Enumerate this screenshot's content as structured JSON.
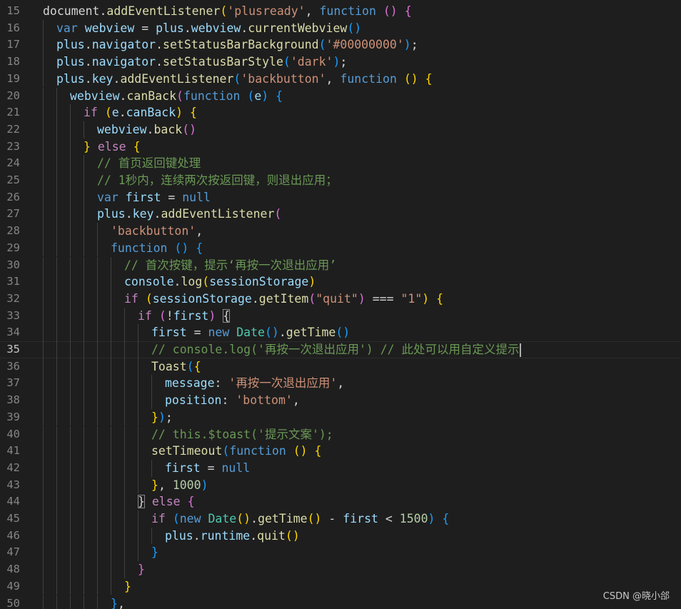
{
  "editor": {
    "current_line": 35,
    "colors": {
      "background": "#1e1e1e",
      "line_number": "#858585",
      "variable": "#9cdcfe",
      "function": "#dcdcaa",
      "keyword": "#569cd6",
      "control": "#c586c0",
      "string": "#ce9178",
      "number": "#b5cea8",
      "comment": "#6a9955",
      "class": "#4ec9b0",
      "bracket_level1": "#ffd700",
      "bracket_level2": "#da70d6",
      "bracket_level3": "#179fff"
    },
    "lines": [
      {
        "num": "15",
        "indent": 0,
        "tokens": [
          [
            "plain",
            "document."
          ],
          [
            "fn",
            "addEventListener"
          ],
          [
            "b1",
            "("
          ],
          [
            "str",
            "'plusready'"
          ],
          [
            "plain",
            ", "
          ],
          [
            "kw",
            "function"
          ],
          [
            "plain",
            " "
          ],
          [
            "b2",
            "()"
          ],
          [
            "plain",
            " "
          ],
          [
            "b2",
            "{"
          ]
        ]
      },
      {
        "num": "16",
        "indent": 1,
        "tokens": [
          [
            "kw",
            "var"
          ],
          [
            "plain",
            " "
          ],
          [
            "var",
            "webview"
          ],
          [
            "plain",
            " = "
          ],
          [
            "var",
            "plus"
          ],
          [
            "plain",
            "."
          ],
          [
            "var",
            "webview"
          ],
          [
            "plain",
            "."
          ],
          [
            "fn",
            "currentWebview"
          ],
          [
            "b3",
            "()"
          ]
        ]
      },
      {
        "num": "17",
        "indent": 1,
        "tokens": [
          [
            "var",
            "plus"
          ],
          [
            "plain",
            "."
          ],
          [
            "var",
            "navigator"
          ],
          [
            "plain",
            "."
          ],
          [
            "fn",
            "setStatusBarBackground"
          ],
          [
            "b3",
            "("
          ],
          [
            "str",
            "'#00000000'"
          ],
          [
            "b3",
            ")"
          ],
          [
            "plain",
            ";"
          ]
        ]
      },
      {
        "num": "18",
        "indent": 1,
        "tokens": [
          [
            "var",
            "plus"
          ],
          [
            "plain",
            "."
          ],
          [
            "var",
            "navigator"
          ],
          [
            "plain",
            "."
          ],
          [
            "fn",
            "setStatusBarStyle"
          ],
          [
            "b3",
            "("
          ],
          [
            "str",
            "'dark'"
          ],
          [
            "b3",
            ")"
          ],
          [
            "plain",
            ";"
          ]
        ]
      },
      {
        "num": "19",
        "indent": 1,
        "tokens": [
          [
            "var",
            "plus"
          ],
          [
            "plain",
            "."
          ],
          [
            "var",
            "key"
          ],
          [
            "plain",
            "."
          ],
          [
            "fn",
            "addEventListener"
          ],
          [
            "b3",
            "("
          ],
          [
            "str",
            "'backbutton'"
          ],
          [
            "plain",
            ", "
          ],
          [
            "kw",
            "function"
          ],
          [
            "plain",
            " "
          ],
          [
            "b1",
            "()"
          ],
          [
            "plain",
            " "
          ],
          [
            "b1",
            "{"
          ]
        ]
      },
      {
        "num": "20",
        "indent": 2,
        "tokens": [
          [
            "var",
            "webview"
          ],
          [
            "plain",
            "."
          ],
          [
            "fn",
            "canBack"
          ],
          [
            "b2",
            "("
          ],
          [
            "kw",
            "function"
          ],
          [
            "plain",
            " "
          ],
          [
            "b3",
            "("
          ],
          [
            "var",
            "e"
          ],
          [
            "b3",
            ")"
          ],
          [
            "plain",
            " "
          ],
          [
            "b3",
            "{"
          ]
        ]
      },
      {
        "num": "21",
        "indent": 3,
        "tokens": [
          [
            "ctrl",
            "if"
          ],
          [
            "plain",
            " "
          ],
          [
            "b1",
            "("
          ],
          [
            "var",
            "e"
          ],
          [
            "plain",
            "."
          ],
          [
            "var",
            "canBack"
          ],
          [
            "b1",
            ")"
          ],
          [
            "plain",
            " "
          ],
          [
            "b1",
            "{"
          ]
        ]
      },
      {
        "num": "22",
        "indent": 4,
        "tokens": [
          [
            "var",
            "webview"
          ],
          [
            "plain",
            "."
          ],
          [
            "fn",
            "back"
          ],
          [
            "b2",
            "()"
          ]
        ]
      },
      {
        "num": "23",
        "indent": 3,
        "tokens": [
          [
            "b1",
            "}"
          ],
          [
            "plain",
            " "
          ],
          [
            "ctrl",
            "else"
          ],
          [
            "plain",
            " "
          ],
          [
            "b1",
            "{"
          ]
        ]
      },
      {
        "num": "24",
        "indent": 4,
        "tokens": [
          [
            "com",
            "// 首页返回键处理"
          ]
        ]
      },
      {
        "num": "25",
        "indent": 4,
        "tokens": [
          [
            "com",
            "// 1秒内，连续两次按返回键，则退出应用；"
          ]
        ]
      },
      {
        "num": "26",
        "indent": 4,
        "tokens": [
          [
            "kw",
            "var"
          ],
          [
            "plain",
            " "
          ],
          [
            "var",
            "first"
          ],
          [
            "plain",
            " = "
          ],
          [
            "kw",
            "null"
          ]
        ]
      },
      {
        "num": "27",
        "indent": 4,
        "tokens": [
          [
            "var",
            "plus"
          ],
          [
            "plain",
            "."
          ],
          [
            "var",
            "key"
          ],
          [
            "plain",
            "."
          ],
          [
            "fn",
            "addEventListener"
          ],
          [
            "b2",
            "("
          ]
        ]
      },
      {
        "num": "28",
        "indent": 5,
        "tokens": [
          [
            "str",
            "'backbutton'"
          ],
          [
            "plain",
            ","
          ]
        ]
      },
      {
        "num": "29",
        "indent": 5,
        "tokens": [
          [
            "kw",
            "function"
          ],
          [
            "plain",
            " "
          ],
          [
            "b3",
            "()"
          ],
          [
            "plain",
            " "
          ],
          [
            "b3",
            "{"
          ]
        ]
      },
      {
        "num": "30",
        "indent": 6,
        "tokens": [
          [
            "com",
            "// 首次按键，提示‘再按一次退出应用’"
          ]
        ]
      },
      {
        "num": "31",
        "indent": 6,
        "tokens": [
          [
            "var",
            "console"
          ],
          [
            "plain",
            "."
          ],
          [
            "fn",
            "log"
          ],
          [
            "b1",
            "("
          ],
          [
            "var",
            "sessionStorage"
          ],
          [
            "b1",
            ")"
          ]
        ]
      },
      {
        "num": "32",
        "indent": 6,
        "tokens": [
          [
            "ctrl",
            "if"
          ],
          [
            "plain",
            " "
          ],
          [
            "b1",
            "("
          ],
          [
            "var",
            "sessionStorage"
          ],
          [
            "plain",
            "."
          ],
          [
            "fn",
            "getItem"
          ],
          [
            "b2",
            "("
          ],
          [
            "str",
            "\"quit\""
          ],
          [
            "b2",
            ")"
          ],
          [
            "plain",
            " === "
          ],
          [
            "str",
            "\"1\""
          ],
          [
            "b1",
            ")"
          ],
          [
            "plain",
            " "
          ],
          [
            "b1",
            "{"
          ]
        ]
      },
      {
        "num": "33",
        "indent": 7,
        "tokens": [
          [
            "ctrl",
            "if"
          ],
          [
            "plain",
            " "
          ],
          [
            "b2",
            "("
          ],
          [
            "plain",
            "!"
          ],
          [
            "var",
            "first"
          ],
          [
            "b2",
            ")"
          ],
          [
            "plain",
            " "
          ],
          [
            "bm",
            "{"
          ]
        ]
      },
      {
        "num": "34",
        "indent": 8,
        "tokens": [
          [
            "var",
            "first"
          ],
          [
            "plain",
            " = "
          ],
          [
            "kw",
            "new"
          ],
          [
            "plain",
            " "
          ],
          [
            "cls",
            "Date"
          ],
          [
            "b3",
            "()"
          ],
          [
            "plain",
            "."
          ],
          [
            "fn",
            "getTime"
          ],
          [
            "b3",
            "()"
          ]
        ]
      },
      {
        "num": "35",
        "indent": 8,
        "cursor": true,
        "tokens": [
          [
            "com",
            "// console.log('再按一次退出应用') // 此处可以用自定义提示"
          ]
        ]
      },
      {
        "num": "36",
        "indent": 8,
        "tokens": [
          [
            "fn",
            "Toast"
          ],
          [
            "b3",
            "("
          ],
          [
            "b1",
            "{"
          ]
        ]
      },
      {
        "num": "37",
        "indent": 9,
        "tokens": [
          [
            "var",
            "message"
          ],
          [
            "plain",
            ": "
          ],
          [
            "str",
            "'再按一次退出应用'"
          ],
          [
            "plain",
            ","
          ]
        ]
      },
      {
        "num": "38",
        "indent": 9,
        "tokens": [
          [
            "var",
            "position"
          ],
          [
            "plain",
            ": "
          ],
          [
            "str",
            "'bottom'"
          ],
          [
            "plain",
            ","
          ]
        ]
      },
      {
        "num": "39",
        "indent": 8,
        "tokens": [
          [
            "b1",
            "}"
          ],
          [
            "b3",
            ")"
          ],
          [
            "plain",
            ";"
          ]
        ]
      },
      {
        "num": "40",
        "indent": 8,
        "tokens": [
          [
            "com",
            "// this.$toast('提示文案');"
          ]
        ]
      },
      {
        "num": "41",
        "indent": 8,
        "tokens": [
          [
            "fn",
            "setTimeout"
          ],
          [
            "b3",
            "("
          ],
          [
            "kw",
            "function"
          ],
          [
            "plain",
            " "
          ],
          [
            "b1",
            "()"
          ],
          [
            "plain",
            " "
          ],
          [
            "b1",
            "{"
          ]
        ]
      },
      {
        "num": "42",
        "indent": 9,
        "tokens": [
          [
            "var",
            "first"
          ],
          [
            "plain",
            " = "
          ],
          [
            "kw",
            "null"
          ]
        ]
      },
      {
        "num": "43",
        "indent": 8,
        "tokens": [
          [
            "b1",
            "}"
          ],
          [
            "plain",
            ", "
          ],
          [
            "num",
            "1000"
          ],
          [
            "b3",
            ")"
          ]
        ]
      },
      {
        "num": "44",
        "indent": 7,
        "tokens": [
          [
            "bm",
            "}"
          ],
          [
            "plain",
            " "
          ],
          [
            "ctrl",
            "else"
          ],
          [
            "plain",
            " "
          ],
          [
            "b2",
            "{"
          ]
        ]
      },
      {
        "num": "45",
        "indent": 8,
        "tokens": [
          [
            "ctrl",
            "if"
          ],
          [
            "plain",
            " "
          ],
          [
            "b3",
            "("
          ],
          [
            "kw",
            "new"
          ],
          [
            "plain",
            " "
          ],
          [
            "cls",
            "Date"
          ],
          [
            "b1",
            "()"
          ],
          [
            "plain",
            "."
          ],
          [
            "fn",
            "getTime"
          ],
          [
            "b1",
            "()"
          ],
          [
            "plain",
            " - "
          ],
          [
            "var",
            "first"
          ],
          [
            "plain",
            " < "
          ],
          [
            "num",
            "1500"
          ],
          [
            "b3",
            ")"
          ],
          [
            "plain",
            " "
          ],
          [
            "b3",
            "{"
          ]
        ]
      },
      {
        "num": "46",
        "indent": 9,
        "tokens": [
          [
            "var",
            "plus"
          ],
          [
            "plain",
            "."
          ],
          [
            "var",
            "runtime"
          ],
          [
            "plain",
            "."
          ],
          [
            "fn",
            "quit"
          ],
          [
            "b1",
            "()"
          ]
        ]
      },
      {
        "num": "47",
        "indent": 8,
        "tokens": [
          [
            "b3",
            "}"
          ]
        ]
      },
      {
        "num": "48",
        "indent": 7,
        "tokens": [
          [
            "b2",
            "}"
          ]
        ]
      },
      {
        "num": "49",
        "indent": 6,
        "tokens": [
          [
            "b1",
            "}"
          ]
        ]
      },
      {
        "num": "50",
        "indent": 5,
        "tokens": [
          [
            "b3",
            "}"
          ],
          [
            "plain",
            ","
          ]
        ]
      }
    ]
  },
  "watermark": "CSDN @晓小郃"
}
